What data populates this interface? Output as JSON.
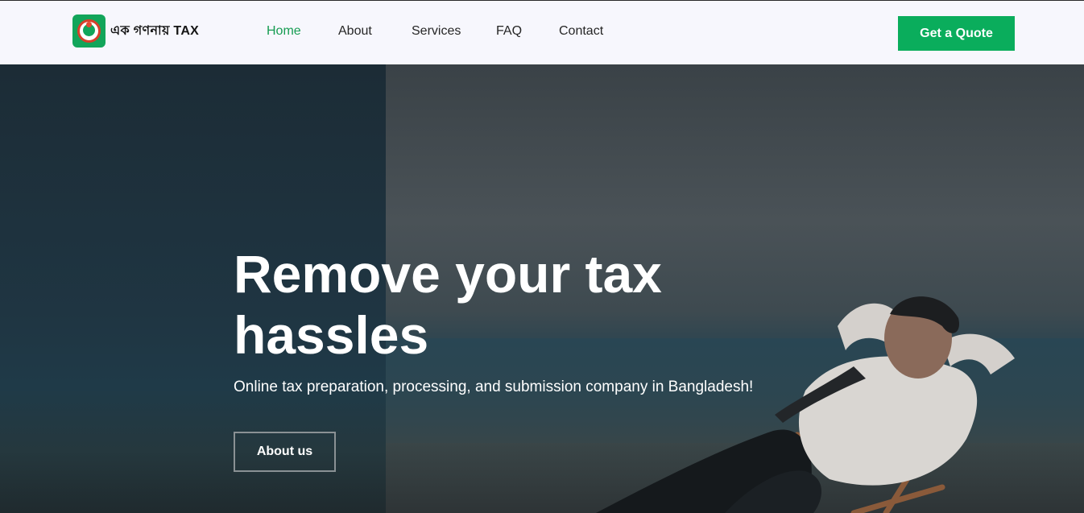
{
  "header": {
    "logo_text": "এক গণনায় TAX",
    "nav": [
      {
        "label": "Home",
        "active": true
      },
      {
        "label": "About",
        "active": false
      },
      {
        "label": "Services",
        "active": false
      },
      {
        "label": "FAQ",
        "active": false
      },
      {
        "label": "Contact",
        "active": false
      }
    ],
    "cta_label": "Get a Quote"
  },
  "hero": {
    "title": "Remove your tax hassles",
    "subtitle": "Online tax preparation, processing, and submission company in Bangladesh!",
    "button_label": "About us"
  },
  "colors": {
    "accent": "#0aad5c",
    "active_nav": "#169c52",
    "header_bg": "#f7f7fd",
    "hero_overlay": "#1f3542"
  }
}
